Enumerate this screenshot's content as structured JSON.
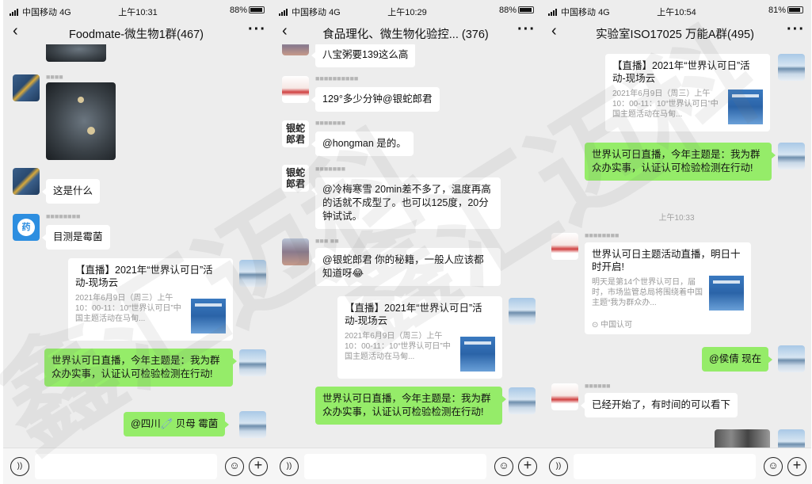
{
  "phones": [
    {
      "status": {
        "carrier": "中国移动",
        "network": "4G",
        "time": "上午10:31",
        "battery": "88%"
      },
      "title": "Foodmate-微生物1群(467)",
      "messages": {
        "m1": "这是什么",
        "m2": "目测是霉菌",
        "card_title": "【直播】2021年“世界认可日”活动-现场云",
        "card_desc": "2021年6月9日（周三）上午10：00-11：10“世界认可日”中国主题活动在马甸...",
        "m3": "世界认可日直播，今年主题是：我为群众办实事，认证认可检验检测在行动!",
        "m4": "@四川🧷 贝母 霉菌"
      },
      "avatar_label": "药"
    },
    {
      "status": {
        "carrier": "中国移动",
        "network": "4G",
        "time": "上午10:29",
        "battery": "88%"
      },
      "title": "食品理化、微生物化验控... (376)",
      "messages": {
        "m0": "八宝粥要139这么高",
        "m1": "129°多少分钟@银蛇郎君",
        "m2": "@hongman 是的。",
        "m3": "@冷梅寒雪 20min差不多了，温度再高的话就不成型了。也可以125度，20分钟试试。",
        "m4": "@银蛇郎君 你的秘籍，一般人应该都知道呀😂",
        "card_title": "【直播】2021年“世界认可日”活动-现场云",
        "card_desc": "2021年6月9日（周三）上午10：00-11：10“世界认可日”中国主题活动在马甸...",
        "m5": "世界认可日直播，今年主题是：我为群众办实事，认证认可检验检测在行动!"
      },
      "calli": "银蛇郎君"
    },
    {
      "status": {
        "carrier": "中国移动",
        "network": "4G",
        "time": "上午10:54",
        "battery": "81%"
      },
      "title": "实验室ISO17025 万能A群(495)",
      "messages": {
        "card_title": "【直播】2021年“世界认可日”活动-现场云",
        "card_desc": "2021年6月9日（周三）上午10：00-11：10“世界认可日”中国主题活动在马甸...",
        "m1": "世界认可日直播，今年主题是：我为群众办实事，认证认可检验检测在行动!",
        "time_label": "上午10:33",
        "card2_title": "世界认可日主题活动直播，明日十时开启!",
        "card2_desc": "明天是第14个世界认可日，届时，市场监管总局将围绕着中国主题“我为群众办...",
        "card2_source": "中国认可",
        "m2": "@侯倩 现在",
        "m3": "已经开始了，有时间的可以看下"
      }
    }
  ],
  "watermark": "鑫汇迈科"
}
